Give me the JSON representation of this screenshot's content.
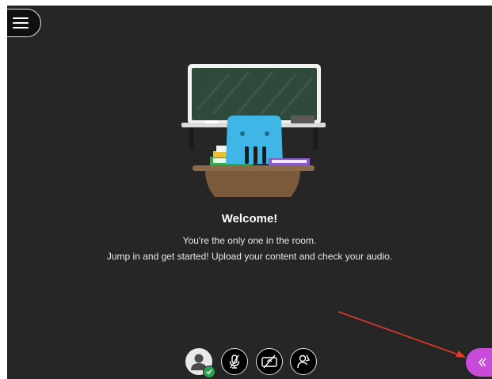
{
  "welcome": {
    "title": "Welcome!",
    "line1": "You're the only one in the room.",
    "line2": "Jump in and get started! Upload your content and check your audio."
  },
  "icons": {
    "menu": "hamburger-menu-icon",
    "avatar": "user-avatar-icon",
    "status": "check-icon",
    "mic": "microphone-off-icon",
    "camera": "camera-off-icon",
    "share": "raise-hand-icon",
    "panel": "double-chevron-left-icon"
  },
  "colors": {
    "background": "#262626",
    "accent": "#c94bd9",
    "status": "#2da24a",
    "annotation_arrow": "#e8392c"
  }
}
